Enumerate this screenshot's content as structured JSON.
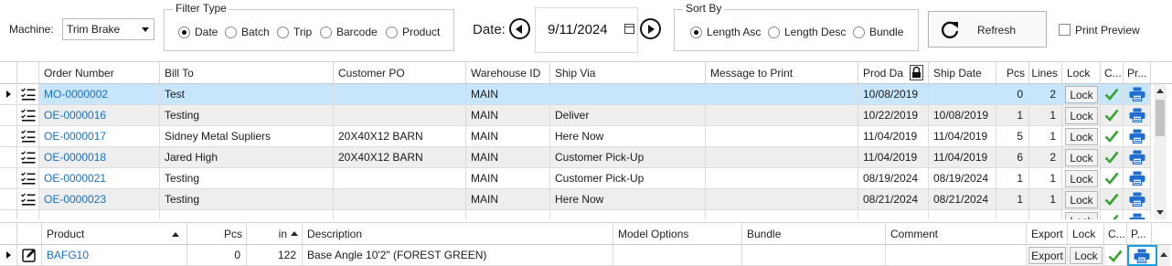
{
  "toolbar": {
    "machine_label": "Machine:",
    "machine_value": "Trim Brake",
    "filter_title": "Filter Type",
    "filter_options": [
      "Date",
      "Batch",
      "Trip",
      "Barcode",
      "Product"
    ],
    "filter_selected": "Date",
    "date_label": "Date:",
    "date_value": "9/11/2024",
    "sort_title": "Sort By",
    "sort_options": [
      "Length Asc",
      "Length Desc",
      "Bundle"
    ],
    "sort_selected": "Length Asc",
    "refresh_label": "Refresh",
    "print_preview_label": "Print Preview"
  },
  "orders": {
    "columns": [
      "Order Number",
      "Bill To",
      "Customer PO",
      "Warehouse ID",
      "Ship Via",
      "Message to Print",
      "Prod Da",
      "Ship Date",
      "Pcs",
      "Lines",
      "Lock",
      "C...",
      "Pr..."
    ],
    "lock_label": "Lock",
    "rows": [
      {
        "order": "MO-0000002",
        "bill_to": "Test",
        "po": "",
        "wh": "MAIN",
        "ship_via": "",
        "msg": "",
        "prod": "10/08/2019",
        "ship": "",
        "pcs": "0",
        "lines": "2"
      },
      {
        "order": "OE-0000016",
        "bill_to": "Testing",
        "po": "",
        "wh": "MAIN",
        "ship_via": "Deliver",
        "msg": "",
        "prod": "10/22/2019",
        "ship": "10/08/2019",
        "pcs": "1",
        "lines": "1"
      },
      {
        "order": "OE-0000017",
        "bill_to": "Sidney Metal Supliers",
        "po": "20X40X12 BARN",
        "wh": "MAIN",
        "ship_via": "Here Now",
        "msg": "",
        "prod": "11/04/2019",
        "ship": "11/04/2019",
        "pcs": "5",
        "lines": "1"
      },
      {
        "order": "OE-0000018",
        "bill_to": "Jared High",
        "po": "20X40X12 BARN",
        "wh": "MAIN",
        "ship_via": "Customer Pick-Up",
        "msg": "",
        "prod": "11/04/2019",
        "ship": "11/04/2019",
        "pcs": "6",
        "lines": "2"
      },
      {
        "order": "OE-0000021",
        "bill_to": "Testing",
        "po": "",
        "wh": "MAIN",
        "ship_via": "Customer Pick-Up",
        "msg": "",
        "prod": "08/19/2024",
        "ship": "08/19/2024",
        "pcs": "1",
        "lines": "1"
      },
      {
        "order": "OE-0000023",
        "bill_to": "Testing",
        "po": "",
        "wh": "MAIN",
        "ship_via": "Here Now",
        "msg": "",
        "prod": "08/21/2024",
        "ship": "08/21/2024",
        "pcs": "1",
        "lines": "1"
      }
    ]
  },
  "products": {
    "columns": [
      "Product",
      "Pcs",
      "in",
      "Description",
      "Model Options",
      "Bundle",
      "Comment",
      "Export",
      "Lock",
      "C...",
      "P..."
    ],
    "export_label": "Export",
    "lock_label": "Lock",
    "rows": [
      {
        "product": "BAFG10",
        "pcs": "0",
        "in": "122",
        "description": "Base Angle 10'2\" (FOREST GREEN)",
        "model_options": "",
        "bundle": "",
        "comment": ""
      }
    ]
  },
  "colors": {
    "selected_row": "#c7e6fb",
    "alt_row": "#eeeeee",
    "link": "#1a6fbf",
    "check": "#3aa335",
    "print": "#1e6fd0",
    "focus": "#1a9ee3"
  }
}
